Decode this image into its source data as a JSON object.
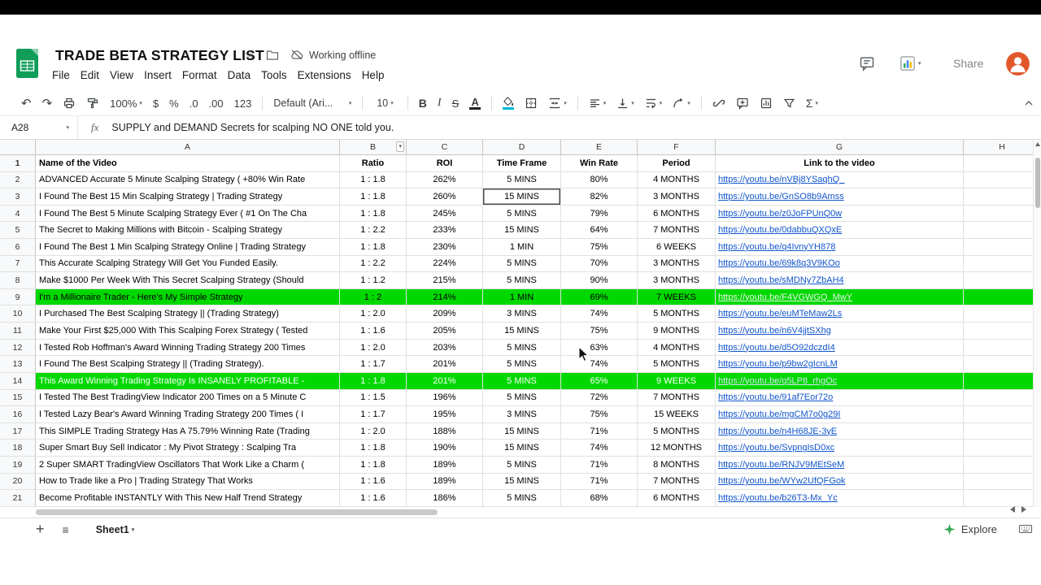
{
  "app": {
    "doc_title": "TRADE BETA STRATEGY LIST",
    "status": "Working offline",
    "share": "Share",
    "menus": [
      "File",
      "Edit",
      "View",
      "Insert",
      "Format",
      "Data",
      "Tools",
      "Extensions",
      "Help"
    ]
  },
  "toolbar": {
    "zoom": "100%",
    "currency": "$",
    "percent": "%",
    "decrease_decimal": ".0",
    "increase_decimal": ".00",
    "number_format": "123",
    "font": "Default (Ari...",
    "size": "10",
    "bold": "B",
    "italic": "I",
    "strikethrough": "S",
    "text_color": "A",
    "functions": "Σ"
  },
  "formula": {
    "cell_ref": "A28",
    "fx_label": "fx",
    "content": "SUPPLY and DEMAND Secrets for scalping NO ONE told you."
  },
  "sheetbar": {
    "tab": "Sheet1",
    "explore": "Explore"
  },
  "colors": {
    "row_highlight": "#00d800",
    "link": "#1155cc",
    "logo_green": "#0f9d58",
    "avatar_orange": "#e2582d",
    "fill_swatch": "#00b8d4"
  },
  "grid": {
    "columns": [
      "A",
      "B",
      "C",
      "D",
      "E",
      "F",
      "G",
      "H"
    ],
    "active_cell": {
      "col": "D",
      "row": 3
    },
    "header_row": {
      "name": "Name of the Video",
      "ratio": "Ratio",
      "roi": "ROI",
      "time_frame": "Time Frame",
      "win_rate": "Win Rate",
      "period": "Period",
      "link": "Link to the video"
    },
    "rows": [
      {
        "row": 2,
        "name": "ADVANCED Accurate 5 Minute Scalping Strategy ( +80% Win Rate",
        "ratio": "1 : 1.8",
        "roi": "262%",
        "time": "5 MINS",
        "win": "80%",
        "period": "4 MONTHS",
        "link": "https://youtu.be/nVBj8YSaqhQ_",
        "hl": null
      },
      {
        "row": 3,
        "name": "I Found The Best 15 Min Scalping Strategy | Trading Strategy",
        "ratio": "1 : 1.8",
        "roi": "260%",
        "time": "15 MINS",
        "win": "82%",
        "period": "3 MONTHS",
        "link": "https://youtu.be/GnSO8b9Amss",
        "hl": null
      },
      {
        "row": 4,
        "name": "I Found The Best 5 Minute Scalping Strategy Ever ( #1 On The Cha",
        "ratio": "1 : 1.8",
        "roi": "245%",
        "time": "5 MINS",
        "win": "79%",
        "period": "6 MONTHS",
        "link": "https://youtu.be/z0JoFPUnQ0w",
        "hl": null
      },
      {
        "row": 5,
        "name": "The Secret to Making Millions with Bitcoin - Scalping Strategy",
        "ratio": "1 : 2.2",
        "roi": "233%",
        "time": "15 MINS",
        "win": "64%",
        "period": "7 MONTHS",
        "link": "https://youtu.be/0dabbuQXQxE",
        "hl": null
      },
      {
        "row": 6,
        "name": "I Found The Best 1 Min Scalping Strategy Online | Trading Strategy",
        "ratio": "1 : 1.8",
        "roi": "230%",
        "time": "1 MIN",
        "win": "75%",
        "period": "6 WEEKS",
        "link": "https://youtu.be/q4IvnyYH878",
        "hl": null
      },
      {
        "row": 7,
        "name": "This Accurate Scalping Strategy Will Get You Funded Easily.",
        "ratio": "1 : 2.2",
        "roi": "224%",
        "time": "5 MINS",
        "win": "70%",
        "period": "3 MONTHS",
        "link": "https://youtu.be/69k8q3V9KOo",
        "hl": null
      },
      {
        "row": 8,
        "name": "Make $1000 Per Week With This Secret Scalping Strategy (Should",
        "ratio": "1 : 1.2",
        "roi": "215%",
        "time": "5 MINS",
        "win": "90%",
        "period": "3 MONTHS",
        "link": "https://youtu.be/sMDNy7ZbAH4",
        "hl": null
      },
      {
        "row": 9,
        "name": "I'm a Millionaire Trader - Here's My Simple Strategy",
        "ratio": "1 : 2",
        "roi": "214%",
        "time": "1 MIN",
        "win": "69%",
        "period": "7 WEEKS",
        "link": "https://youtu.be/F4VGWGQ_MwY",
        "hl": "green"
      },
      {
        "row": 10,
        "name": "I Purchased The Best Scalping Strategy || (Trading Strategy)",
        "ratio": "1 : 2.0",
        "roi": "209%",
        "time": "3 MINS",
        "win": "74%",
        "period": "5 MONTHS",
        "link": "https://youtu.be/euMTeMaw2Ls",
        "hl": null
      },
      {
        "row": 11,
        "name": "Make Your First $25,000 With This Scalping Forex Strategy ( Tested",
        "ratio": "1 : 1.6",
        "roi": "205%",
        "time": "15 MINS",
        "win": "75%",
        "period": "9 MONTHS",
        "link": "https://youtu.be/n6V4jjtSXhg",
        "hl": null
      },
      {
        "row": 12,
        "name": "I Tested Rob Hoffman's Award Winning Trading Strategy 200 Times",
        "ratio": "1 : 2.0",
        "roi": "203%",
        "time": "5 MINS",
        "win": "63%",
        "period": "4 MONTHS",
        "link": "https://youtu.be/d5O92dczdI4",
        "hl": null
      },
      {
        "row": 13,
        "name": "I Found The Best Scalping Strategy || (Trading Strategy).",
        "ratio": "1 : 1.7",
        "roi": "201%",
        "time": "5 MINS",
        "win": "74%",
        "period": "5 MONTHS",
        "link": "https://youtu.be/p9bw2gIcnLM",
        "hl": null
      },
      {
        "row": 14,
        "name": "This Award Winning Trading Strategy Is INSANELY PROFITABLE -",
        "ratio": "1 : 1.8",
        "roi": "201%",
        "time": "5 MINS",
        "win": "65%",
        "period": "9 WEEKS",
        "link": "https://youtu.be/q5LP8_rhgOc",
        "hl": "green-white"
      },
      {
        "row": 15,
        "name": "I Tested The Best TradingView Indicator 200 Times on a 5 Minute C",
        "ratio": "1 : 1.5",
        "roi": "196%",
        "time": "5 MINS",
        "win": "72%",
        "period": "7 MONTHS",
        "link": "https://youtu.be/91af7Eor72o",
        "hl": null
      },
      {
        "row": 16,
        "name": "I Tested Lazy Bear's Award Winning Trading Strategy 200 Times ( I",
        "ratio": "1 : 1.7",
        "roi": "195%",
        "time": "3 MINS",
        "win": "75%",
        "period": "15 WEEKS",
        "link": "https://youtu.be/mgCM7o0g29I",
        "hl": null
      },
      {
        "row": 17,
        "name": "This SIMPLE Trading Strategy Has A 75.79% Winning Rate (Trading",
        "ratio": "1 : 2.0",
        "roi": "188%",
        "time": "15 MINS",
        "win": "71%",
        "period": "5 MONTHS",
        "link": "https://youtu.be/n4H68JE-3yE",
        "hl": null
      },
      {
        "row": 18,
        "name": "Super Smart Buy Sell Indicator : My Pivot Strategy : Scalping Tra",
        "ratio": "1 : 1.8",
        "roi": "190%",
        "time": "15 MINS",
        "win": "74%",
        "period": "12 MONTHS",
        "link": "https://youtu.be/SvpngIsD0xc",
        "hl": null
      },
      {
        "row": 19,
        "name": "2 Super SMART TradingView Oscillators That Work Like a Charm (",
        "ratio": "1 : 1.8",
        "roi": "189%",
        "time": "5 MINS",
        "win": "71%",
        "period": "8 MONTHS",
        "link": "https://youtu.be/RNJV9MEtSeM",
        "hl": null
      },
      {
        "row": 20,
        "name": "How to Trade like a Pro | Trading Strategy That Works",
        "ratio": "1 : 1.6",
        "roi": "189%",
        "time": "15 MINS",
        "win": "71%",
        "period": "7 MONTHS",
        "link": "https://youtu.be/WYw2UfQFGok",
        "hl": null
      },
      {
        "row": 21,
        "name": "Become Profitable INSTANTLY With This New Half Trend Strategy",
        "ratio": "1 : 1.6",
        "roi": "186%",
        "time": "5 MINS",
        "win": "68%",
        "period": "6 MONTHS",
        "link": "https://youtu.be/b26T3-Mx_Yc",
        "hl": null
      }
    ]
  }
}
